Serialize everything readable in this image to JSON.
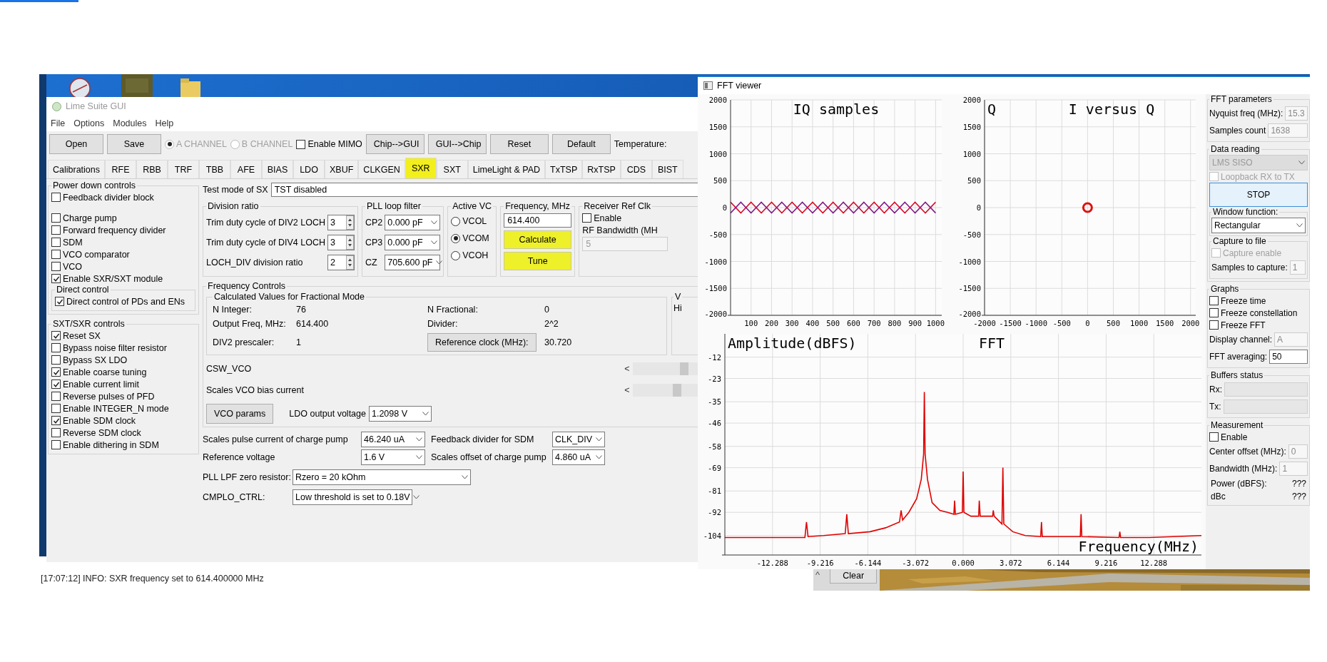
{
  "wallpaper": {
    "kind": "picture"
  },
  "lime_window": {
    "title": "Lime Suite GUI",
    "menu": [
      "File",
      "Options",
      "Modules",
      "Help"
    ],
    "toolbar": {
      "buttons_left": [
        "Open",
        "Save"
      ],
      "channels": [
        {
          "label": "A CHANNEL",
          "selected": true
        },
        {
          "label": "B CHANNEL",
          "selected": false
        }
      ],
      "mimo": {
        "label": "Enable MIMO",
        "checked": false
      },
      "buttons_right": [
        "Chip-->GUI",
        "GUI-->Chip",
        "Reset",
        "Default"
      ],
      "temperature_label": "Temperature:"
    },
    "tabs": [
      {
        "label": "Calibrations",
        "selected": false,
        "highlighted": false
      },
      {
        "label": "RFE",
        "selected": false,
        "highlighted": false
      },
      {
        "label": "RBB",
        "selected": false,
        "highlighted": false
      },
      {
        "label": "TRF",
        "selected": false,
        "highlighted": false
      },
      {
        "label": "TBB",
        "selected": false,
        "highlighted": false
      },
      {
        "label": "AFE",
        "selected": false,
        "highlighted": false
      },
      {
        "label": "BIAS",
        "selected": false,
        "highlighted": false
      },
      {
        "label": "LDO",
        "selected": false,
        "highlighted": false
      },
      {
        "label": "XBUF",
        "selected": false,
        "highlighted": false
      },
      {
        "label": "CLKGEN",
        "selected": false,
        "highlighted": false
      },
      {
        "label": "SXR",
        "selected": true,
        "highlighted": true
      },
      {
        "label": "SXT",
        "selected": false,
        "highlighted": false
      },
      {
        "label": "LimeLight & PAD",
        "selected": false,
        "highlighted": false
      },
      {
        "label": "TxTSP",
        "selected": false,
        "highlighted": false
      },
      {
        "label": "RxTSP",
        "selected": false,
        "highlighted": false
      },
      {
        "label": "CDS",
        "selected": false,
        "highlighted": false
      },
      {
        "label": "BIST",
        "selected": false,
        "highlighted": false
      }
    ],
    "power_down": {
      "title": "Power down controls",
      "item_groups": [
        [
          {
            "label": "Feedback divider block",
            "checked": false
          }
        ],
        [
          {
            "label": "Charge pump",
            "checked": false
          },
          {
            "label": "Forward frequency divider",
            "checked": false
          },
          {
            "label": "SDM",
            "checked": false
          },
          {
            "label": "VCO comparator",
            "checked": false
          },
          {
            "label": "VCO",
            "checked": false
          },
          {
            "label": "Enable SXR/SXT module",
            "checked": true
          }
        ]
      ],
      "direct_control": {
        "title": "Direct control",
        "items": [
          {
            "label": "Direct control of PDs and ENs",
            "checked": true
          }
        ]
      }
    },
    "sx_controls": {
      "title": "SXT/SXR controls",
      "items": [
        {
          "label": "Reset SX",
          "checked": true
        },
        {
          "label": "Bypass noise filter resistor",
          "checked": false
        },
        {
          "label": "Bypass SX LDO",
          "checked": false
        },
        {
          "label": "Enable coarse tuning",
          "checked": true
        },
        {
          "label": "Enable current limit",
          "checked": true
        },
        {
          "label": "Reverse pulses of PFD",
          "checked": false
        },
        {
          "label": "Enable INTEGER_N mode",
          "checked": false
        },
        {
          "label": "Enable SDM clock",
          "checked": true
        },
        {
          "label": "Reverse SDM clock",
          "checked": false
        },
        {
          "label": "Enable dithering in SDM",
          "checked": false
        }
      ]
    },
    "test_mode": {
      "label": "Test mode of SX",
      "value": "TST disabled"
    },
    "division_ratio": {
      "title": "Division ratio",
      "rows": [
        {
          "label": "Trim duty cycle of DIV2 LOCH",
          "value": "3"
        },
        {
          "label": "Trim duty cycle of DIV4 LOCH",
          "value": "3"
        },
        {
          "label": "LOCH_DIV division ratio",
          "value": "2"
        }
      ]
    },
    "pll_loop_filter": {
      "title": "PLL loop filter",
      "rows": [
        {
          "label": "CP2",
          "value": "0.000 pF"
        },
        {
          "label": "CP3",
          "value": "0.000 pF"
        },
        {
          "label": "CZ",
          "value": "705.600 pF"
        }
      ]
    },
    "active_vco": {
      "title": "Active VC",
      "options": [
        {
          "label": "VCOL",
          "selected": false
        },
        {
          "label": "VCOM",
          "selected": true
        },
        {
          "label": "VCOH",
          "selected": false
        }
      ]
    },
    "frequency": {
      "title": "Frequency, MHz",
      "value": "614.400",
      "buttons": [
        {
          "label": "Calculate",
          "highlighted": true
        },
        {
          "label": "Tune",
          "highlighted": true
        }
      ]
    },
    "receiver_ref_clk": {
      "title": "Receiver Ref Clk",
      "enable": {
        "label": "Enable",
        "checked": false
      },
      "bandwidth_label": "RF Bandwidth (MH",
      "bandwidth_value": "5"
    },
    "frequency_controls": {
      "title": "Frequency Controls",
      "calculated": {
        "title": "Calculated Values for Fractional Mode",
        "rows": [
          {
            "kind": "text",
            "label": "N Integer:",
            "value": "76"
          },
          {
            "kind": "text",
            "label": "N Fractional:",
            "value": "0"
          },
          {
            "kind": "text",
            "label": "Output Freq, MHz:",
            "value": "614.400"
          },
          {
            "kind": "text",
            "label": "Divider:",
            "value": "2^2"
          },
          {
            "kind": "text",
            "label": "DIV2 prescaler:",
            "value": "1"
          },
          {
            "kind": "button",
            "label": "Reference clock (MHz):",
            "value": "30.720"
          }
        ]
      },
      "side_group": {
        "title": "V",
        "text": "Hi"
      },
      "sliders": [
        {
          "label": "CSW_VCO",
          "arrow": "<",
          "level": 0.72
        },
        {
          "label": "Scales VCO bias current",
          "arrow": "<",
          "level": 0.62
        }
      ],
      "vco_params_button": "VCO params",
      "ldo": {
        "label": "LDO output voltage",
        "value": "1.2098 V"
      }
    },
    "settings": [
      {
        "label": "Scales pulse current of charge pump",
        "value": "46.240 uA"
      },
      {
        "label": "Feedback divider for SDM",
        "value": "CLK_DIV"
      },
      {
        "label": "Reference voltage",
        "value": "1.6 V"
      },
      {
        "label": "Scales offset of charge pump",
        "value": "4.860 uA"
      }
    ],
    "zero_resistor": {
      "label": "PLL LPF zero resistor:",
      "value": "Rzero = 20 kOhm"
    },
    "cmplo": {
      "label": "CMPLO_CTRL:",
      "value": "Low threshold is set to 0.18V"
    }
  },
  "log": [
    "[17:07:12] INFO: SXR frequency set to 614.400000 MHz"
  ],
  "log_controls": {
    "caret": "^",
    "clear": "Clear"
  },
  "fft_window": {
    "title": "FFT viewer",
    "iq_chart": {
      "chart_data": {
        "type": "line",
        "title": "IQ samples",
        "x": [
          0,
          50,
          100,
          150,
          200,
          250,
          300,
          350,
          400,
          450,
          500,
          550,
          600,
          650,
          700,
          750,
          800,
          850,
          900,
          950,
          1000
        ],
        "xlim": [
          0,
          1030
        ],
        "ylim": [
          -2000,
          2000
        ],
        "grid": true,
        "xticks": [
          100,
          200,
          300,
          400,
          500,
          600,
          700,
          800,
          900,
          1000
        ],
        "yticks": [
          -2000,
          -1500,
          -1000,
          -500,
          0,
          500,
          1000,
          1500,
          2000
        ],
        "series": [
          {
            "color": "#d8102c",
            "values": [
              100,
              -100,
              100,
              -100,
              100,
              -100,
              100,
              -100,
              100,
              -100,
              100,
              -100,
              100,
              -100,
              100,
              -100,
              100,
              -100,
              100,
              -100,
              100
            ]
          },
          {
            "color": "#80208a",
            "values": [
              -100,
              100,
              -100,
              100,
              -100,
              100,
              -100,
              100,
              -100,
              100,
              -100,
              100,
              -100,
              100,
              -100,
              100,
              -100,
              100,
              -100,
              100,
              -100
            ]
          }
        ]
      }
    },
    "constellation_chart": {
      "chart_data": {
        "type": "scatter",
        "title": "I versus Q",
        "ylabel": "Q",
        "x": [
          0
        ],
        "xlim": [
          -2000,
          2100
        ],
        "ylim": [
          -2000,
          2000
        ],
        "grid": true,
        "xticks": [
          -2000,
          -1500,
          -1000,
          -500,
          0,
          500,
          1000,
          1500,
          2000
        ],
        "yticks": [
          -2000,
          -1500,
          -1000,
          -500,
          0,
          500,
          1000,
          1500,
          2000
        ],
        "series": [
          {
            "color": "#e01010",
            "values": [
              0
            ]
          }
        ]
      }
    },
    "fft_chart": {
      "chart_data": {
        "type": "line",
        "title": "FFT",
        "ylabel": "Amplitude(dBFS)",
        "xlabel": "Frequency(MHz)",
        "xlim": [
          -15.36,
          15.36
        ],
        "ylim": [
          -114,
          0
        ],
        "grid": true,
        "x": [
          -15.36,
          -12,
          -10.2,
          -10.1,
          -10.0,
          -9,
          -7.6,
          -7.5,
          -7.4,
          -6,
          -5,
          -4.1,
          -4.0,
          -3.9,
          -3.5,
          -3,
          -2.7,
          -2.55,
          -2.5,
          -2.45,
          -2.3,
          -2,
          -1.5,
          -1,
          -0.6,
          -0.55,
          -0.5,
          -0.05,
          0,
          0.05,
          0.5,
          1.0,
          1.04,
          1.1,
          1.9,
          1.94,
          2.0,
          2.5,
          2.56,
          2.62,
          3.2,
          4,
          5.0,
          5.05,
          5.1,
          7.55,
          7.6,
          7.65,
          10.05,
          10.1,
          10.15,
          12,
          15.36
        ],
        "xticks": [
          {
            "value": -12.288,
            "label": "-12.288"
          },
          {
            "value": -9.216,
            "label": "-9.216"
          },
          {
            "value": -6.144,
            "label": "-6.144"
          },
          {
            "value": -3.072,
            "label": "-3.072"
          },
          {
            "value": 0,
            "label": "0.000"
          },
          {
            "value": 3.072,
            "label": "3.072"
          },
          {
            "value": 6.144,
            "label": "6.144"
          },
          {
            "value": 9.216,
            "label": "9.216"
          },
          {
            "value": 12.288,
            "label": "12.288"
          }
        ],
        "yticks": [
          -104,
          -92,
          -81,
          -69,
          -58,
          -46,
          -35,
          -23,
          -12
        ],
        "series": [
          {
            "color": "#e00000",
            "values": [
              -105,
              -105,
              -105,
              -97,
              -104.5,
              -104,
              -103,
              -93,
              -103,
              -102,
              -100,
              -97,
              -91,
              -96,
              -92,
              -85,
              -75,
              -62,
              -30,
              -62,
              -75,
              -87,
              -91,
              -92,
              -93,
              -86,
              -93,
              -92,
              -71,
              -92,
              -94,
              -94,
              -86,
              -94,
              -94,
              -91,
              -94,
              -98,
              -69,
              -98,
              -102,
              -104,
              -104.5,
              -97,
              -104.5,
              -104.5,
              -93,
              -104.5,
              -105,
              -102,
              -105,
              -105,
              -104
            ]
          }
        ]
      }
    },
    "panel": {
      "fft_parameters": {
        "title": "FFT parameters",
        "rows": [
          {
            "label": "Nyquist freq (MHz):",
            "value": "15.3"
          },
          {
            "label": "Samples count",
            "value": "1638"
          }
        ]
      },
      "data_reading": {
        "title": "Data reading",
        "mode": {
          "value": "LMS SISO",
          "disabled": true
        },
        "loopback": {
          "label": "Loopback RX to TX",
          "checked": false,
          "disabled": true
        },
        "stop": "STOP",
        "window_function": {
          "title": "Window function:",
          "value": "Rectangular"
        },
        "capture": {
          "title": "Capture to file",
          "enable": {
            "label": "Capture enable",
            "checked": false,
            "disabled": true
          },
          "samples_label": "Samples to capture:",
          "samples_value": "1"
        }
      },
      "graphs": {
        "title": "Graphs",
        "toggles": [
          {
            "label": "Freeze time",
            "checked": false
          },
          {
            "label": "Freeze constellation",
            "checked": false
          },
          {
            "label": "Freeze FFT",
            "checked": false
          }
        ],
        "display_channel": {
          "label": "Display channel:",
          "value": "A",
          "disabled": true
        },
        "averaging": {
          "label": "FFT averaging:",
          "value": "50"
        }
      },
      "buffers": {
        "title": "Buffers status",
        "bars": [
          {
            "label": "Rx:",
            "level": 0
          },
          {
            "label": "Tx:",
            "level": 0
          }
        ]
      },
      "measurement": {
        "title": "Measurement",
        "enable": {
          "label": "Enable",
          "checked": false
        },
        "fields": [
          {
            "label": "Center offset (MHz):",
            "value": "0"
          },
          {
            "label": "Bandwidth (MHz):",
            "value": "1"
          }
        ],
        "readings": [
          {
            "label": "Power (dBFS):",
            "value": "???"
          },
          {
            "label": "dBc",
            "value": "???"
          }
        ]
      }
    }
  }
}
